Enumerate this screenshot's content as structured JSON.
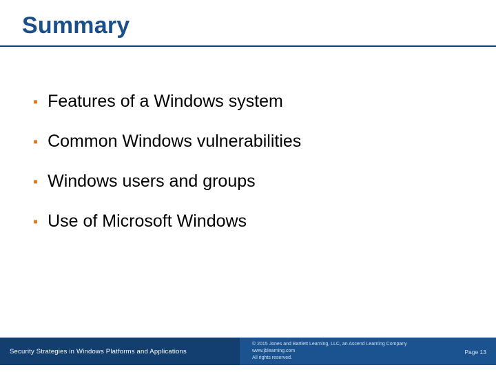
{
  "colors": {
    "brand_blue": "#1a4f8a",
    "deep_blue": "#123f6f",
    "mid_blue": "#1a538f",
    "accent_orange": "#e07a1f"
  },
  "title": "Summary",
  "bullets": [
    "Features of a Windows system",
    "Common Windows vulnerabilities",
    "Windows users and groups",
    "Use of Microsoft Windows"
  ],
  "footer": {
    "book_title": "Security Strategies in Windows Platforms and Applications",
    "copyright": "© 2015 Jones and Bartlett Learning, LLC, an Ascend Learning Company",
    "url": "www.jblearning.com",
    "rights": "All rights reserved.",
    "page_label": "Page 13"
  }
}
